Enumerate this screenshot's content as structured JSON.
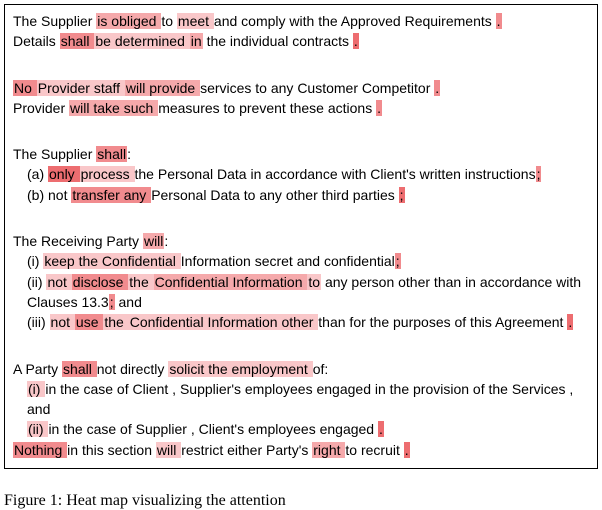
{
  "blocks": [
    {
      "lines": [
        {
          "indent": false,
          "runs": [
            {
              "t": "The Supplier ",
              "hl": 0
            },
            {
              "t": "is obliged ",
              "hl": 3
            },
            {
              "t": "to ",
              "hl": 0
            },
            {
              "t": "meet ",
              "hl": 2
            },
            {
              "t": "and comply with the Approved Requirements ",
              "hl": 0
            },
            {
              "t": ".",
              "hl": 4
            }
          ]
        },
        {
          "indent": false,
          "runs": [
            {
              "t": "Details ",
              "hl": 0
            },
            {
              "t": "shall ",
              "hl": 4
            },
            {
              "t": "be determined ",
              "hl": 2
            },
            {
              "t": "in",
              "hl": 3
            },
            {
              "t": " the individual contracts ",
              "hl": 0
            },
            {
              "t": ".",
              "hl": 5
            }
          ]
        }
      ]
    },
    {
      "lines": [
        {
          "indent": false,
          "runs": [
            {
              "t": "No ",
              "hl": 4
            },
            {
              "t": "Provider staff ",
              "hl": 2
            },
            {
              "t": "will provide ",
              "hl": 3
            },
            {
              "t": "services to any Customer Competitor ",
              "hl": 0
            },
            {
              "t": ".",
              "hl": 4
            }
          ]
        },
        {
          "indent": false,
          "runs": [
            {
              "t": "Provider ",
              "hl": 0
            },
            {
              "t": "will take such ",
              "hl": 3
            },
            {
              "t": "measures to prevent these actions ",
              "hl": 0
            },
            {
              "t": ".",
              "hl": 4
            }
          ]
        }
      ]
    },
    {
      "lines": [
        {
          "indent": false,
          "runs": [
            {
              "t": "The Supplier ",
              "hl": 0
            },
            {
              "t": "shall",
              "hl": 4
            },
            {
              "t": ":",
              "hl": 0
            }
          ]
        },
        {
          "indent": true,
          "runs": [
            {
              "t": "(a) ",
              "hl": 0
            },
            {
              "t": "only ",
              "hl": 5
            },
            {
              "t": "process ",
              "hl": 2
            },
            {
              "t": "the Personal Data in accordance with Client's written instructions",
              "hl": 0
            },
            {
              "t": ";",
              "hl": 4
            }
          ]
        },
        {
          "indent": true,
          "runs": [
            {
              "t": "(b) not ",
              "hl": 0
            },
            {
              "t": "transfer any ",
              "hl": 4
            },
            {
              "t": "Personal Data to any other third parties ",
              "hl": 0
            },
            {
              "t": ";",
              "hl": 5
            }
          ]
        }
      ]
    },
    {
      "lines": [
        {
          "indent": false,
          "runs": [
            {
              "t": "The Receiving Party ",
              "hl": 0
            },
            {
              "t": "will",
              "hl": 3
            },
            {
              "t": ":",
              "hl": 0
            }
          ]
        },
        {
          "indent": true,
          "runs": [
            {
              "t": "(i) ",
              "hl": 0
            },
            {
              "t": "keep the Confidential ",
              "hl": 2
            },
            {
              "t": "Information secret and confidential",
              "hl": 0
            },
            {
              "t": ";",
              "hl": 4
            }
          ]
        },
        {
          "indent": true,
          "runs": [
            {
              "t": "(ii) ",
              "hl": 0
            },
            {
              "t": "not ",
              "hl": 2
            },
            {
              "t": "disclose ",
              "hl": 4
            },
            {
              "t": "the ",
              "hl": 2
            },
            {
              "t": "Confidential Information ",
              "hl": 3
            },
            {
              "t": "to",
              "hl": 2
            },
            {
              "t": " any person other than in accordance with",
              "hl": 0
            }
          ]
        },
        {
          "indent": true,
          "runs": [
            {
              "t": "Clauses 13.3",
              "hl": 0
            },
            {
              "t": ";",
              "hl": 4
            },
            {
              "t": " and",
              "hl": 0
            }
          ]
        },
        {
          "indent": true,
          "runs": [
            {
              "t": "(iii) ",
              "hl": 0
            },
            {
              "t": "not ",
              "hl": 2
            },
            {
              "t": "use ",
              "hl": 4
            },
            {
              "t": "the ",
              "hl": 2
            },
            {
              "t": "Confidential Information other ",
              "hl": 2
            },
            {
              "t": "than for the purposes of this Agreement ",
              "hl": 0
            },
            {
              "t": ".",
              "hl": 5
            }
          ]
        }
      ]
    },
    {
      "lines": [
        {
          "indent": false,
          "runs": [
            {
              "t": "A Party ",
              "hl": 0
            },
            {
              "t": "shall ",
              "hl": 4
            },
            {
              "t": "not directly ",
              "hl": 0
            },
            {
              "t": "solicit the employment ",
              "hl": 2
            },
            {
              "t": "of:",
              "hl": 0
            }
          ]
        },
        {
          "indent": true,
          "runs": [
            {
              "t": "(i) ",
              "hl": 2
            },
            {
              "t": "in the case of Client , Supplier's employees engaged in the provision of the Services , and",
              "hl": 0
            }
          ]
        },
        {
          "indent": true,
          "runs": [
            {
              "t": "(ii) ",
              "hl": 2
            },
            {
              "t": "in the case of Supplier , Client's employees engaged ",
              "hl": 0
            },
            {
              "t": ".",
              "hl": 5
            }
          ]
        },
        {
          "indent": false,
          "runs": [
            {
              "t": "Nothing ",
              "hl": 4
            },
            {
              "t": "in this section ",
              "hl": 0
            },
            {
              "t": "will ",
              "hl": 2
            },
            {
              "t": "restrict either Party's ",
              "hl": 0
            },
            {
              "t": "right ",
              "hl": 3
            },
            {
              "t": "to recruit ",
              "hl": 0
            },
            {
              "t": ".",
              "hl": 5
            }
          ]
        }
      ]
    }
  ],
  "caption": {
    "prefix": "Figure 1:",
    "text": " Heat map visualizing the attention"
  }
}
